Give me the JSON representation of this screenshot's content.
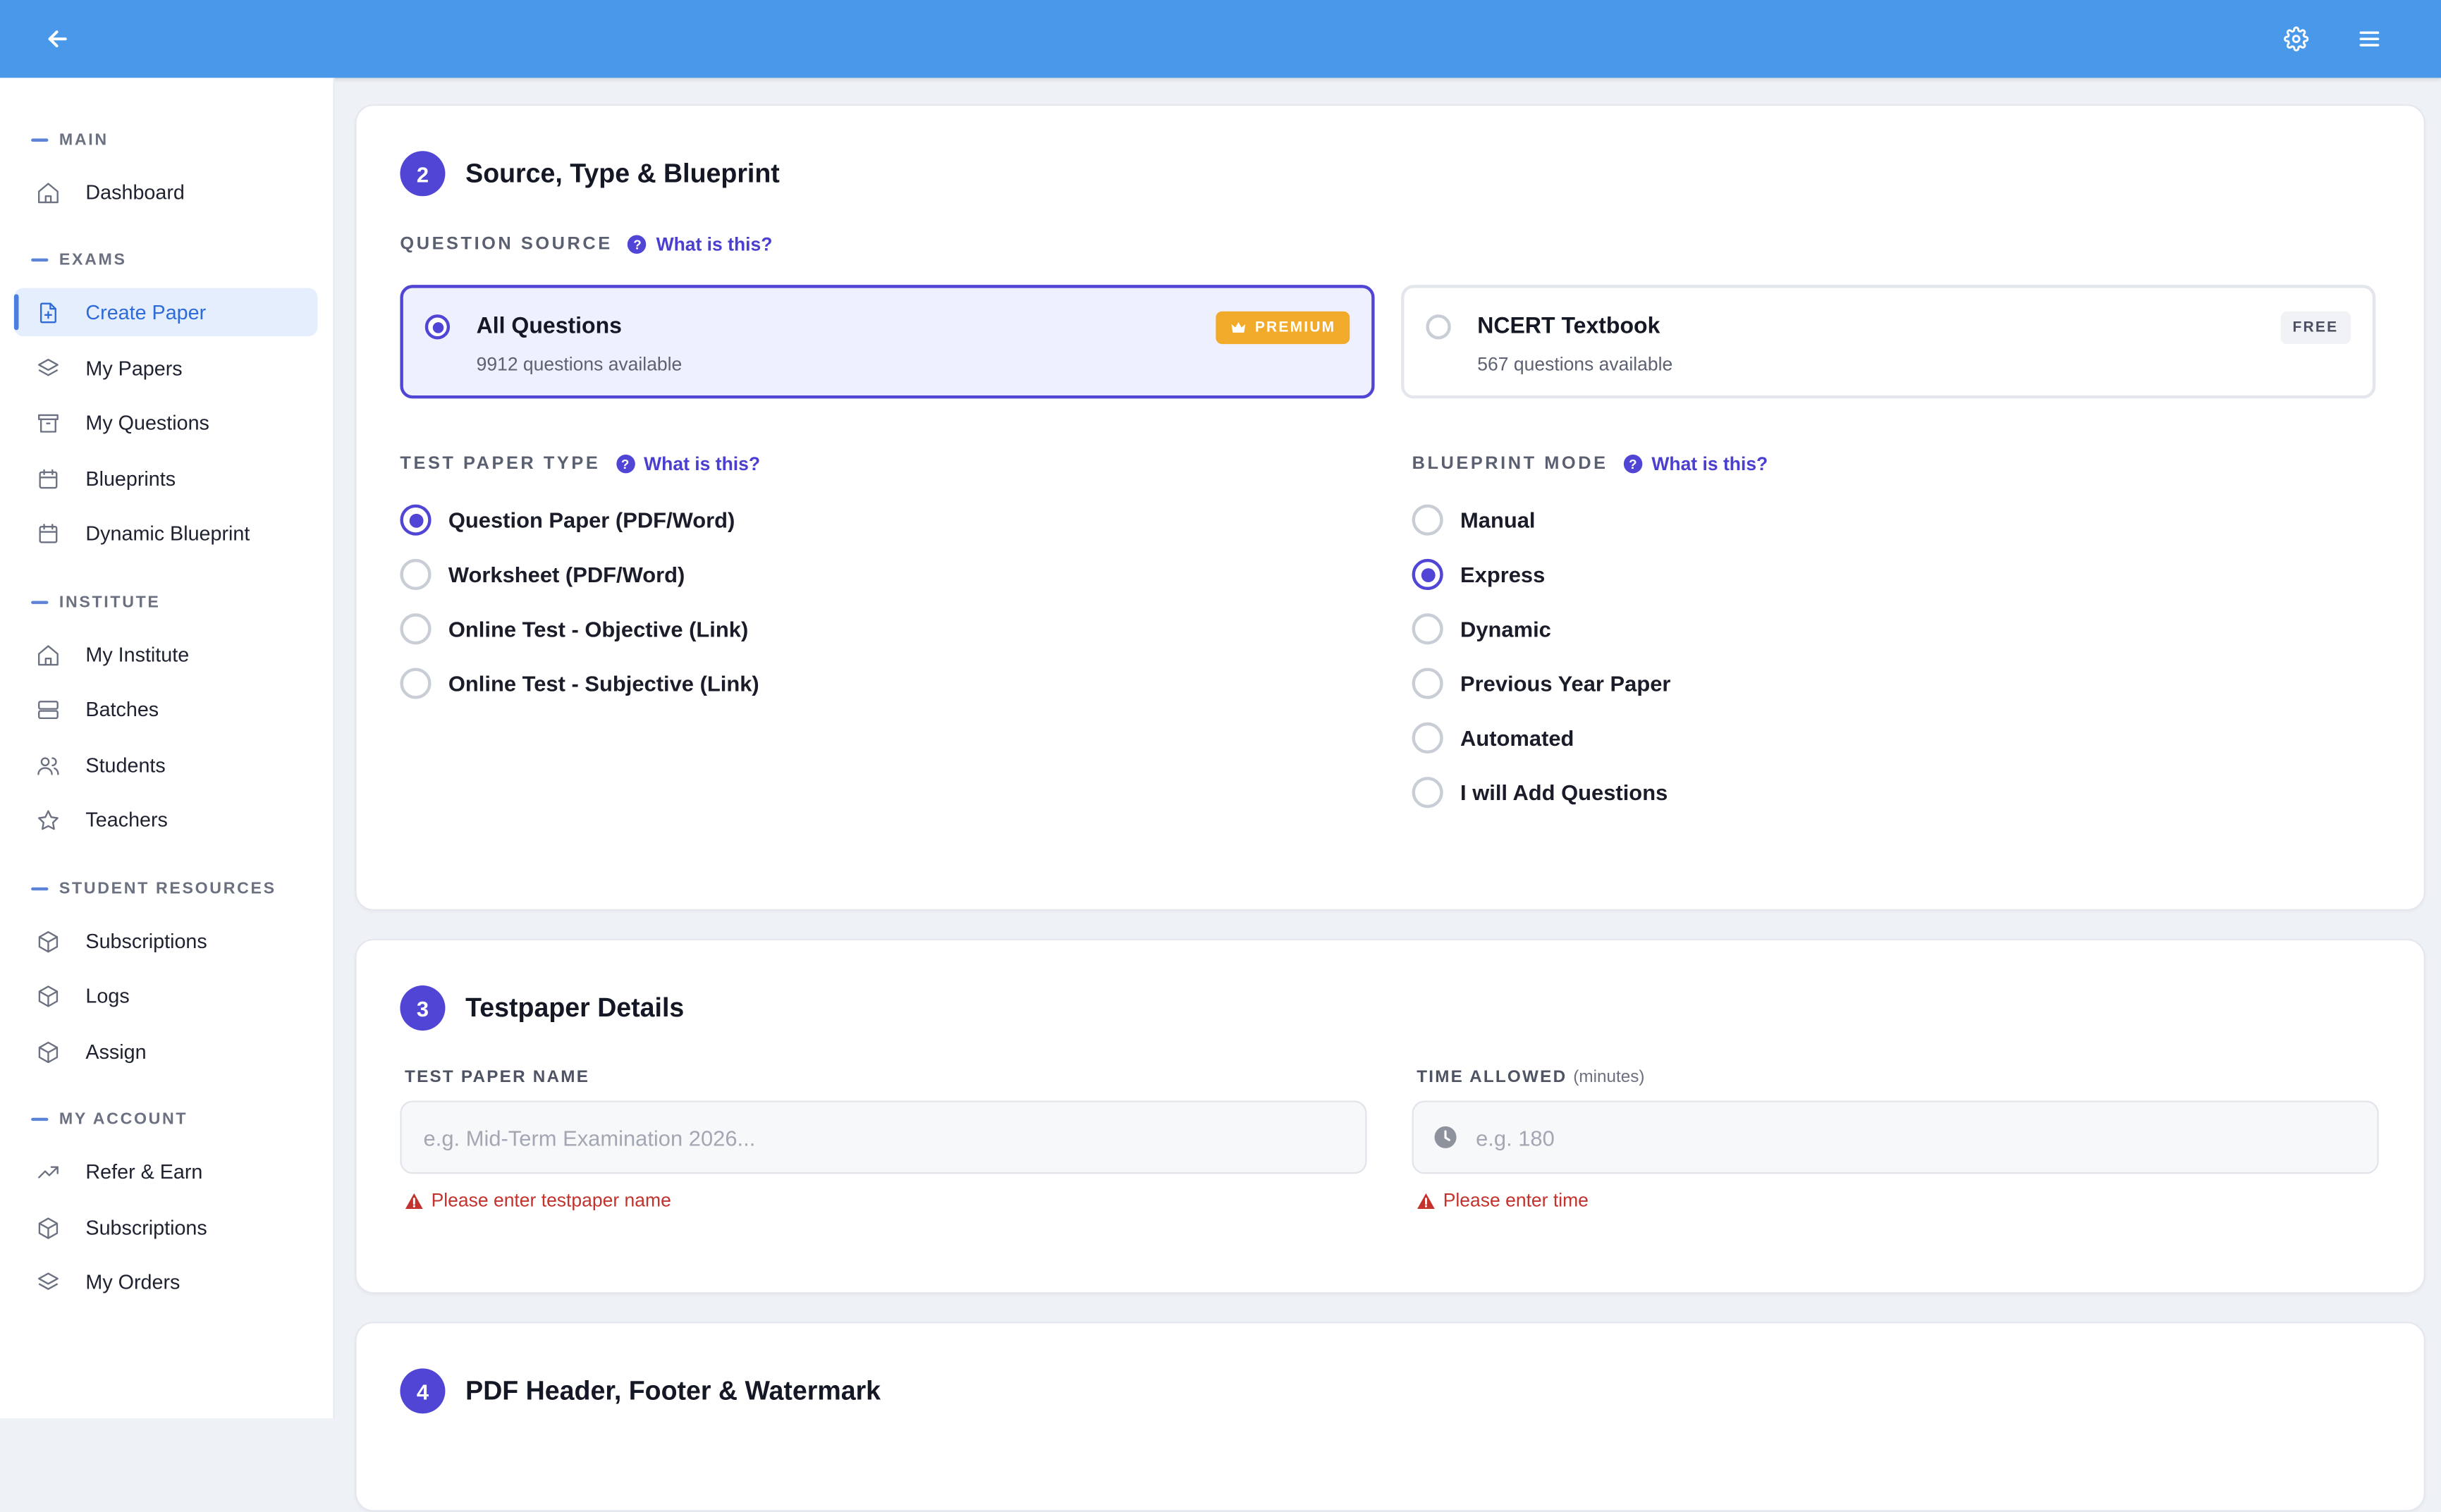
{
  "topbar": {
    "back_icon": "arrow-left-icon",
    "settings_icon": "gear-icon",
    "menu_icon": "hamburger-menu-icon"
  },
  "colors": {
    "topbar": "#4a98e9",
    "accent": "#5145d6",
    "link": "#4b3fd0",
    "active_nav": "#2f6bd8",
    "premium": "#f2aa2a",
    "error": "#c3322c"
  },
  "sidebar": {
    "sections": [
      {
        "title": "MAIN",
        "items": [
          {
            "label": "Dashboard",
            "icon": "home-icon"
          }
        ]
      },
      {
        "title": "EXAMS",
        "items": [
          {
            "label": "Create Paper",
            "icon": "file-plus-icon",
            "active": true
          },
          {
            "label": "My Papers",
            "icon": "layers-icon"
          },
          {
            "label": "My Questions",
            "icon": "archive-icon"
          },
          {
            "label": "Blueprints",
            "icon": "calendar-icon"
          },
          {
            "label": "Dynamic Blueprint",
            "icon": "calendar-icon"
          }
        ]
      },
      {
        "title": "INSTITUTE",
        "items": [
          {
            "label": "My Institute",
            "icon": "home-icon"
          },
          {
            "label": "Batches",
            "icon": "server-icon"
          },
          {
            "label": "Students",
            "icon": "users-icon"
          },
          {
            "label": "Teachers",
            "icon": "star-icon"
          }
        ]
      },
      {
        "title": "STUDENT RESOURCES",
        "items": [
          {
            "label": "Subscriptions",
            "icon": "package-icon"
          },
          {
            "label": "Logs",
            "icon": "package-icon"
          },
          {
            "label": "Assign",
            "icon": "package-icon"
          }
        ]
      },
      {
        "title": "MY ACCOUNT",
        "items": [
          {
            "label": "Refer & Earn",
            "icon": "trending-up-icon"
          },
          {
            "label": "Subscriptions",
            "icon": "package-icon"
          },
          {
            "label": "My Orders",
            "icon": "layers-icon"
          }
        ]
      }
    ]
  },
  "section2": {
    "step": "2",
    "title": "Source, Type & Blueprint",
    "help_mark": "?",
    "question_source": {
      "label": "QUESTION SOURCE",
      "help": "What is this?",
      "options": [
        {
          "title": "All Questions",
          "subtitle": "9912 questions available",
          "badge": "PREMIUM",
          "badge_icon": "crown-icon",
          "selected": true
        },
        {
          "title": "NCERT Textbook",
          "subtitle": "567 questions available",
          "badge": "FREE",
          "selected": false
        }
      ]
    },
    "test_paper_type": {
      "label": "TEST PAPER TYPE",
      "help": "What is this?",
      "options": [
        {
          "label": "Question Paper (PDF/Word)",
          "selected": true
        },
        {
          "label": "Worksheet (PDF/Word)",
          "selected": false
        },
        {
          "label": "Online Test - Objective (Link)",
          "selected": false
        },
        {
          "label": "Online Test - Subjective (Link)",
          "selected": false
        }
      ]
    },
    "blueprint_mode": {
      "label": "BLUEPRINT MODE",
      "help": "What is this?",
      "options": [
        {
          "label": "Manual",
          "selected": false
        },
        {
          "label": "Express",
          "selected": true
        },
        {
          "label": "Dynamic",
          "selected": false
        },
        {
          "label": "Previous Year Paper",
          "selected": false
        },
        {
          "label": "Automated",
          "selected": false
        },
        {
          "label": "I will Add Questions",
          "selected": false
        }
      ]
    }
  },
  "section3": {
    "step": "3",
    "title": "Testpaper Details",
    "name_field": {
      "label": "TEST PAPER NAME",
      "placeholder": "e.g. Mid-Term Examination 2026...",
      "value": "",
      "error": "Please enter testpaper name"
    },
    "time_field": {
      "label": "TIME ALLOWED",
      "unit": "(minutes)",
      "placeholder": "e.g. 180",
      "value": "",
      "icon": "clock-icon",
      "error": "Please enter time"
    }
  },
  "section4": {
    "step": "4",
    "title": "PDF Header, Footer & Watermark"
  }
}
